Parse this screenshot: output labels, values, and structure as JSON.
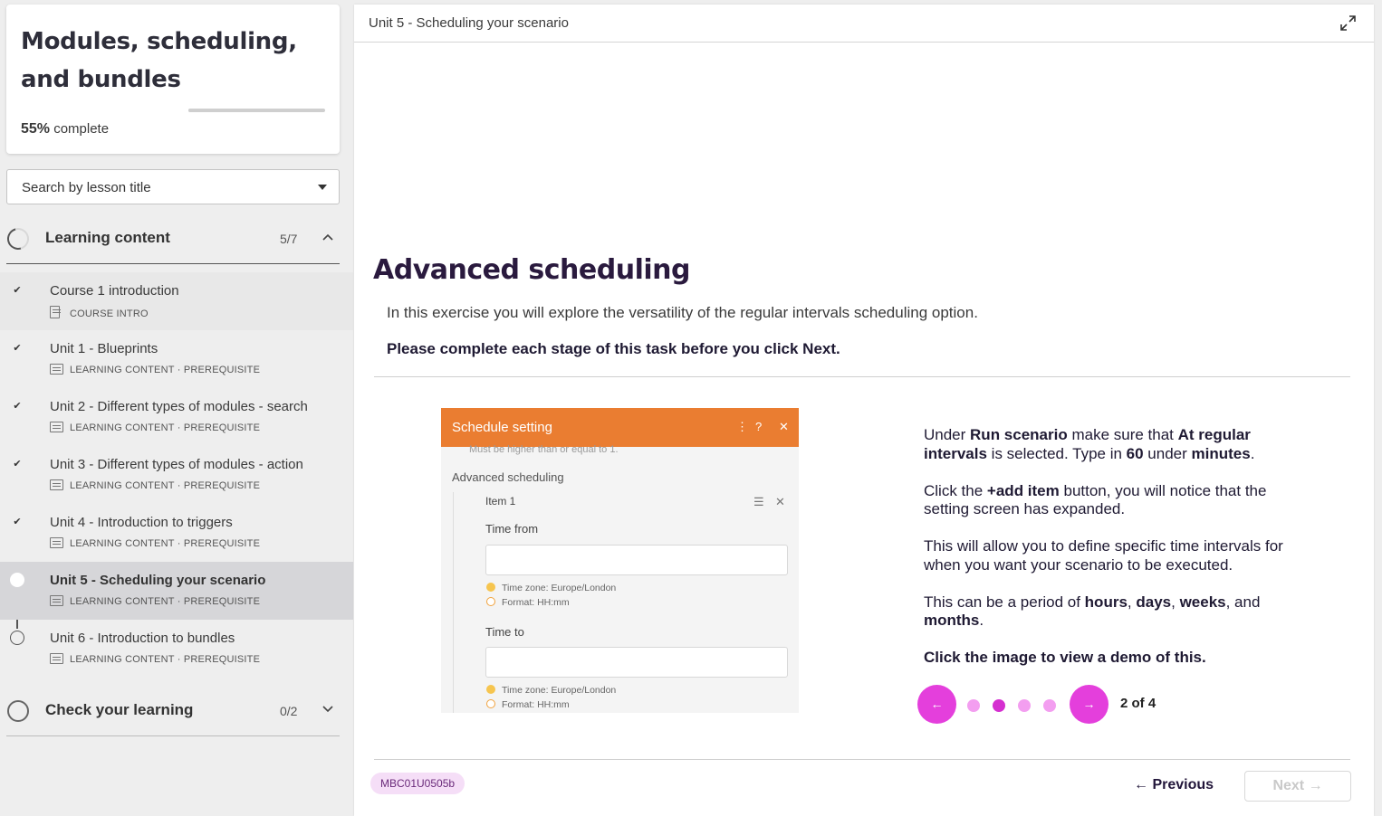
{
  "sidebar": {
    "course_title": "Modules, scheduling, and bundles",
    "progress_percent": "55%",
    "progress_suffix": "complete",
    "progress_fraction": 0.55,
    "search_placeholder": "Search by lesson title",
    "sections": [
      {
        "title": "Learning content",
        "count": "5/7",
        "expanded": true,
        "lessons": [
          {
            "title": "Course 1 introduction",
            "meta": "COURSE INTRO",
            "status": "done"
          },
          {
            "title": "Unit 1 - Blueprints",
            "meta": "LEARNING CONTENT · PREREQUISITE",
            "status": "done"
          },
          {
            "title": "Unit 2 - Different types of modules - search",
            "meta": "LEARNING CONTENT · PREREQUISITE",
            "status": "done"
          },
          {
            "title": "Unit 3 - Different types of modules - action",
            "meta": "LEARNING CONTENT · PREREQUISITE",
            "status": "done"
          },
          {
            "title": "Unit 4 - Introduction to triggers",
            "meta": "LEARNING CONTENT · PREREQUISITE",
            "status": "done"
          },
          {
            "title": "Unit 5 - Scheduling your scenario",
            "meta": "LEARNING CONTENT · PREREQUISITE",
            "status": "current"
          },
          {
            "title": "Unit 6 - Introduction to bundles",
            "meta": "LEARNING CONTENT · PREREQUISITE",
            "status": "not-started"
          }
        ]
      },
      {
        "title": "Check your learning",
        "count": "0/2",
        "expanded": false
      }
    ]
  },
  "main": {
    "header_title": "Unit 5 - Scheduling your scenario",
    "heading": "Advanced scheduling",
    "intro": "In this exercise you will explore the versatility of the regular intervals scheduling option.",
    "instruction": "Please complete each stage of this task before you click Next.",
    "screenshot": {
      "bar_title": "Schedule setting",
      "bar_icons": [
        "⋮",
        "?",
        "✕"
      ],
      "cut_text": "Must be higher than or equal to 1.",
      "section_label": "Advanced scheduling",
      "item_label": "Item 1",
      "time_from_label": "Time from",
      "time_to_label": "Time to",
      "timezone_note": "Time zone: Europe/London",
      "format_note": "Format: HH:mm"
    },
    "slide": {
      "p1_a": "Under ",
      "p1_b": "Run scenario",
      "p1_c": " make sure that ",
      "p1_d": "At regular intervals",
      "p1_e": " is selected. Type in ",
      "p1_f": "60",
      "p1_g": " under ",
      "p1_h": "minutes",
      "p1_i": ".",
      "p2_a": "Click the ",
      "p2_b": "+add item",
      "p2_c": " button, you will notice that the setting screen has expanded.",
      "p3": "This will allow you to define specific time intervals for when you want your scenario to be executed.",
      "p4_a": "This can be a period of ",
      "p4_b": "hours",
      "p4_c": ", ",
      "p4_d": "days",
      "p4_e": ", ",
      "p4_f": "weeks",
      "p4_g": ", and ",
      "p4_h": "months",
      "p4_i": ".",
      "p5": "Click the image to view a demo of this."
    },
    "pager": {
      "prev_icon": "←",
      "next_icon": "→",
      "total": 4,
      "current": 2,
      "counter_text": "2 of 4"
    },
    "footer": {
      "code_badge": "MBC01U0505b",
      "previous_label": "← Previous",
      "next_label": "Next →"
    }
  },
  "colors": {
    "accent": "#e43fdc",
    "accent_dark": "#d52fd0",
    "accent_light": "#f39ef0",
    "heading": "#2a1a3e",
    "screenshot_bar": "#ea7d31"
  }
}
